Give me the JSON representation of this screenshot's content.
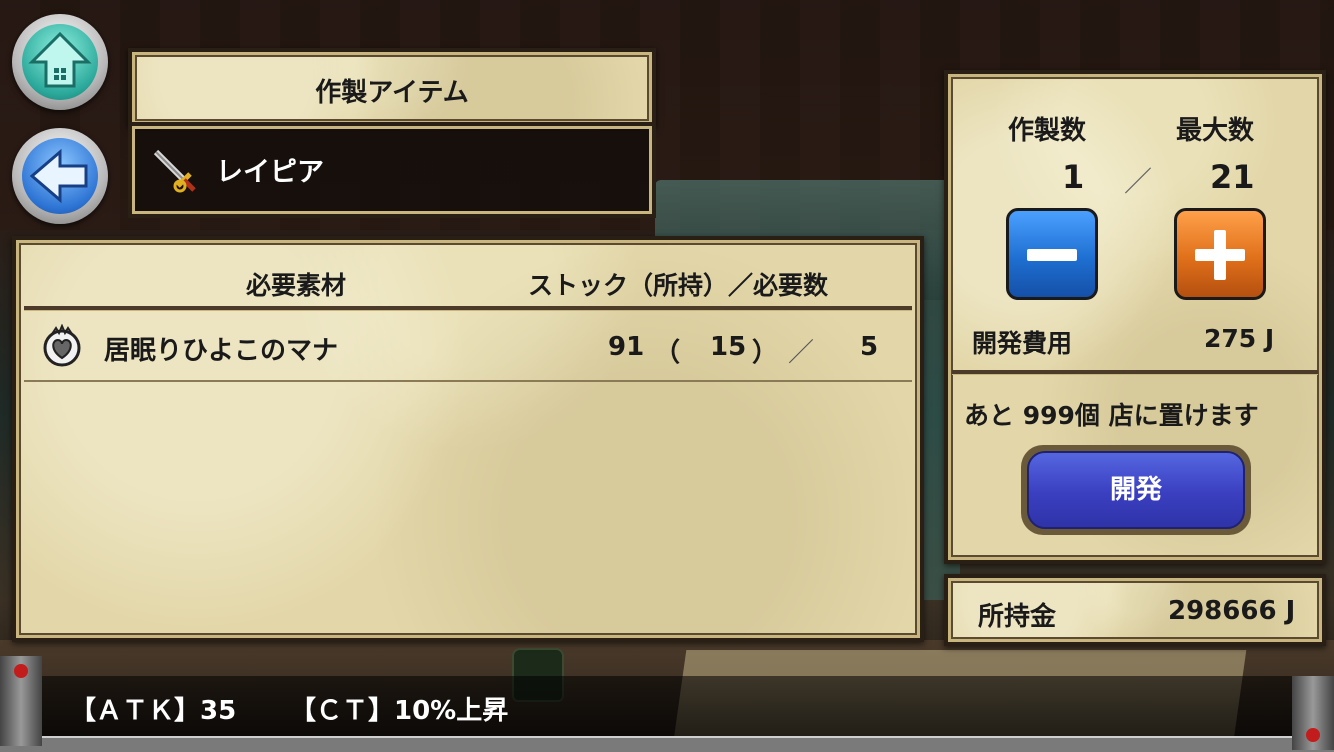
{
  "crafted_item": {
    "header": "作製アイテム",
    "name": "レイピア",
    "icon": "rapier-sword-icon"
  },
  "materials": {
    "header_material": "必要素材",
    "header_counts": "ストック（所持）／必要数",
    "rows": [
      {
        "icon": "mana-heart-icon",
        "name": "居眠りひよこのマナ",
        "stock": "91",
        "open_paren": "（",
        "owned": "15",
        "close_paren": "）",
        "slash": "／",
        "required": "5"
      }
    ]
  },
  "quantity": {
    "make_label": "作製数",
    "max_label": "最大数",
    "make_value": "1",
    "slash": "／",
    "max_value": "21",
    "minus_icon": "minus-icon",
    "plus_icon": "plus-icon",
    "cost_label": "開発費用",
    "cost_value": "275 J"
  },
  "shop": {
    "remaining_text": "あと 999個 店に置けます",
    "develop_label": "開発"
  },
  "money": {
    "label": "所持金",
    "value": "298666 J"
  },
  "status": {
    "atk": "【ＡＴＫ】35",
    "ct": "【ＣＴ】10%上昇"
  },
  "nav": {
    "home_icon": "home-up-arrow-icon",
    "back_icon": "back-arrow-icon"
  },
  "colors": {
    "parchment": "#e3d7a9",
    "minus_button": "#1e6fd1",
    "plus_button": "#e0701a",
    "develop_button": "#3a3fc0"
  }
}
